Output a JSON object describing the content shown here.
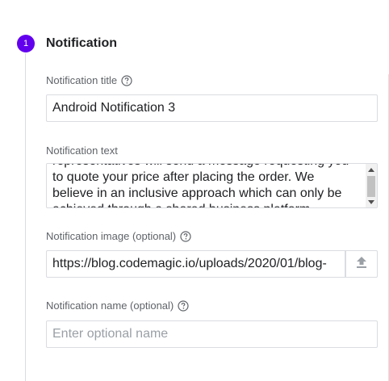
{
  "step": {
    "number": "1",
    "title": "Notification"
  },
  "fields": {
    "title": {
      "label": "Notification title",
      "value": "Android Notification 3"
    },
    "text": {
      "label": "Notification text",
      "lines": [
        "representatives will send a message requesting you",
        "to quote your price after placing the order.  We",
        "believe in an inclusive approach which can only be",
        "achieved through a shared business platform"
      ]
    },
    "image": {
      "label": "Notification image (optional)",
      "value": "https://blog.codemagic.io/uploads/2020/01/blog-"
    },
    "name": {
      "label": "Notification name (optional)",
      "placeholder": "Enter optional name"
    }
  },
  "icons": {
    "help": "help-circle-icon",
    "upload": "upload-icon"
  },
  "colors": {
    "accent": "#6200ee",
    "border": "#dadce0",
    "label": "#5f6368"
  }
}
